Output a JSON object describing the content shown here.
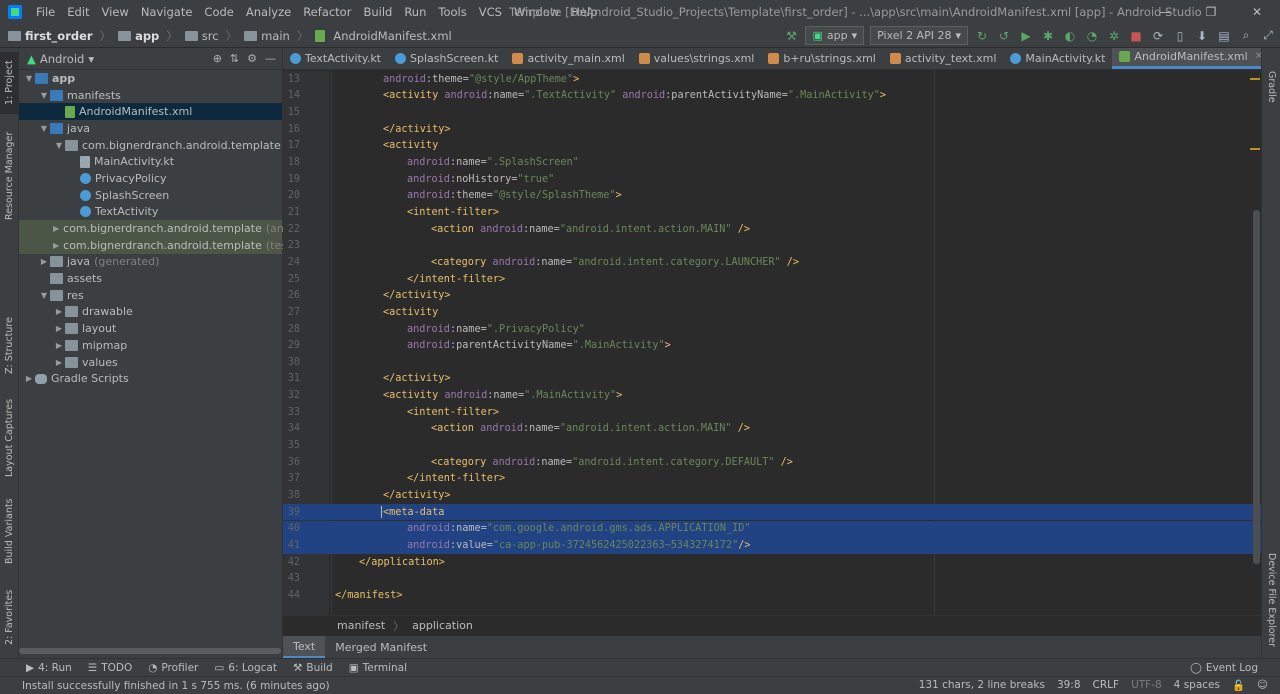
{
  "window": {
    "menu": [
      "File",
      "Edit",
      "View",
      "Navigate",
      "Code",
      "Analyze",
      "Refactor",
      "Build",
      "Run",
      "Tools",
      "VCS",
      "Window",
      "Help"
    ],
    "title": "Template [D:\\Android_Studio_Projects\\Template\\first_order] - ...\\app\\src\\main\\AndroidManifest.xml [app] - Android Studio",
    "controls": {
      "minimize": "—",
      "restore": "❐",
      "close": "✕"
    }
  },
  "breadcrumb": {
    "items": [
      "first_order",
      "app",
      "src",
      "main",
      "AndroidManifest.xml"
    ]
  },
  "run_toolbar": {
    "config": "app",
    "device": "Pixel 2 API 28"
  },
  "left_tool_windows": [
    "1: Project",
    "Resource Manager",
    "Z: Structure",
    "Layout Captures",
    "Build Variants",
    "2: Favorites"
  ],
  "right_tool_windows": [
    "Gradle",
    "Device File Explorer"
  ],
  "project_panel": {
    "view": "Android",
    "tree": [
      {
        "label": "app",
        "depth": 0,
        "expanded": true,
        "icon": "folder-blue",
        "bold": true
      },
      {
        "label": "manifests",
        "depth": 1,
        "expanded": true,
        "icon": "folder-blue"
      },
      {
        "label": "AndroidManifest.xml",
        "depth": 2,
        "icon": "manifest",
        "selected": true
      },
      {
        "label": "java",
        "depth": 1,
        "expanded": true,
        "icon": "folder-blue"
      },
      {
        "label": "com.bignerdranch.android.template",
        "depth": 2,
        "expanded": true,
        "icon": "package"
      },
      {
        "label": "MainActivity.kt",
        "depth": 3,
        "icon": "kt-file"
      },
      {
        "label": "PrivacyPolicy",
        "depth": 3,
        "icon": "kt-class"
      },
      {
        "label": "SplashScreen",
        "depth": 3,
        "icon": "kt-class"
      },
      {
        "label": "TextActivity",
        "depth": 3,
        "icon": "kt-class"
      },
      {
        "label": "com.bignerdranch.android.template",
        "suffix": "(androidT",
        "depth": 2,
        "collapsed": true,
        "icon": "package",
        "green": true
      },
      {
        "label": "com.bignerdranch.android.template",
        "suffix": "(test)",
        "depth": 2,
        "collapsed": true,
        "icon": "package",
        "green": true
      },
      {
        "label": "java",
        "suffix": "(generated)",
        "depth": 1,
        "collapsed": true,
        "icon": "folder"
      },
      {
        "label": "assets",
        "depth": 1,
        "icon": "folder"
      },
      {
        "label": "res",
        "depth": 1,
        "expanded": true,
        "icon": "folder"
      },
      {
        "label": "drawable",
        "depth": 2,
        "collapsed": true,
        "icon": "folder"
      },
      {
        "label": "layout",
        "depth": 2,
        "collapsed": true,
        "icon": "folder"
      },
      {
        "label": "mipmap",
        "depth": 2,
        "collapsed": true,
        "icon": "folder"
      },
      {
        "label": "values",
        "depth": 2,
        "collapsed": true,
        "icon": "folder"
      },
      {
        "label": "Gradle Scripts",
        "depth": 0,
        "collapsed": true,
        "icon": "gradle"
      }
    ]
  },
  "editor_tabs": [
    {
      "label": "TextActivity.kt",
      "icon": "kt"
    },
    {
      "label": "SplashScreen.kt",
      "icon": "kt"
    },
    {
      "label": "activity_main.xml",
      "icon": "xml"
    },
    {
      "label": "values\\strings.xml",
      "icon": "xml"
    },
    {
      "label": "b+ru\\strings.xml",
      "icon": "xml"
    },
    {
      "label": "activity_text.xml",
      "icon": "xml"
    },
    {
      "label": "MainActivity.kt",
      "icon": "kt"
    },
    {
      "label": "AndroidManifest.xml",
      "icon": "manifest",
      "active": true
    }
  ],
  "code_lines": [
    {
      "n": 13,
      "indent": 2,
      "parts": [
        [
          "ns",
          "android"
        ],
        [
          "at",
          ":theme="
        ],
        [
          "vl",
          "\"@style/AppTheme\""
        ],
        [
          "tg",
          ">"
        ]
      ]
    },
    {
      "n": 14,
      "indent": 2,
      "parts": [
        [
          "tg",
          "<activity "
        ],
        [
          "ns",
          "android"
        ],
        [
          "at",
          ":name="
        ],
        [
          "vl",
          "\".TextActivity\" "
        ],
        [
          "ns",
          "android"
        ],
        [
          "at",
          ":parentActivityName="
        ],
        [
          "vl",
          "\".MainActivity\""
        ],
        [
          "tg",
          ">"
        ]
      ]
    },
    {
      "n": 15,
      "indent": 0,
      "parts": []
    },
    {
      "n": 16,
      "indent": 2,
      "parts": [
        [
          "tg",
          "</activity>"
        ]
      ]
    },
    {
      "n": 17,
      "indent": 2,
      "parts": [
        [
          "tg",
          "<activity"
        ]
      ]
    },
    {
      "n": 18,
      "indent": 3,
      "parts": [
        [
          "ns",
          "android"
        ],
        [
          "at",
          ":name="
        ],
        [
          "vl",
          "\".SplashScreen\""
        ]
      ]
    },
    {
      "n": 19,
      "indent": 3,
      "parts": [
        [
          "ns",
          "android"
        ],
        [
          "at",
          ":noHistory="
        ],
        [
          "vl",
          "\"true\""
        ]
      ]
    },
    {
      "n": 20,
      "indent": 3,
      "parts": [
        [
          "ns",
          "android"
        ],
        [
          "at",
          ":theme="
        ],
        [
          "vl",
          "\"@style/SplashTheme\""
        ],
        [
          "tg",
          ">"
        ]
      ]
    },
    {
      "n": 21,
      "indent": 3,
      "parts": [
        [
          "tg",
          "<intent-filter>"
        ]
      ]
    },
    {
      "n": 22,
      "indent": 4,
      "parts": [
        [
          "tg",
          "<action "
        ],
        [
          "ns",
          "android"
        ],
        [
          "at",
          ":name="
        ],
        [
          "vl",
          "\"android.intent.action.MAIN\" "
        ],
        [
          "tg",
          "/>"
        ]
      ]
    },
    {
      "n": 23,
      "indent": 0,
      "parts": []
    },
    {
      "n": 24,
      "indent": 4,
      "parts": [
        [
          "tg",
          "<category "
        ],
        [
          "ns",
          "android"
        ],
        [
          "at",
          ":name="
        ],
        [
          "vl",
          "\"android.intent.category.LAUNCHER\" "
        ],
        [
          "tg",
          "/>"
        ]
      ]
    },
    {
      "n": 25,
      "indent": 3,
      "parts": [
        [
          "tg",
          "</intent-filter>"
        ]
      ]
    },
    {
      "n": 26,
      "indent": 2,
      "parts": [
        [
          "tg",
          "</activity>"
        ]
      ]
    },
    {
      "n": 27,
      "indent": 2,
      "parts": [
        [
          "tg",
          "<activity"
        ]
      ]
    },
    {
      "n": 28,
      "indent": 3,
      "parts": [
        [
          "ns",
          "android"
        ],
        [
          "at",
          ":name="
        ],
        [
          "vl",
          "\".PrivacyPolicy\""
        ]
      ]
    },
    {
      "n": 29,
      "indent": 3,
      "parts": [
        [
          "ns",
          "android"
        ],
        [
          "at",
          ":parentActivityName="
        ],
        [
          "vl",
          "\".MainActivity\""
        ],
        [
          "tg",
          ">"
        ]
      ]
    },
    {
      "n": 30,
      "indent": 0,
      "parts": []
    },
    {
      "n": 31,
      "indent": 2,
      "parts": [
        [
          "tg",
          "</activity>"
        ]
      ]
    },
    {
      "n": 32,
      "indent": 2,
      "parts": [
        [
          "tg",
          "<activity "
        ],
        [
          "ns",
          "android"
        ],
        [
          "at",
          ":name="
        ],
        [
          "vl",
          "\".MainActivity\""
        ],
        [
          "tg",
          ">"
        ]
      ]
    },
    {
      "n": 33,
      "indent": 3,
      "parts": [
        [
          "tg",
          "<intent-filter>"
        ]
      ]
    },
    {
      "n": 34,
      "indent": 4,
      "parts": [
        [
          "tg",
          "<action "
        ],
        [
          "ns",
          "android"
        ],
        [
          "at",
          ":name="
        ],
        [
          "vl",
          "\"android.intent.action.MAIN\" "
        ],
        [
          "tg",
          "/>"
        ]
      ]
    },
    {
      "n": 35,
      "indent": 0,
      "parts": []
    },
    {
      "n": 36,
      "indent": 4,
      "parts": [
        [
          "tg",
          "<category "
        ],
        [
          "ns",
          "android"
        ],
        [
          "at",
          ":name="
        ],
        [
          "vl",
          "\"android.intent.category.DEFAULT\" "
        ],
        [
          "tg",
          "/>"
        ]
      ]
    },
    {
      "n": 37,
      "indent": 3,
      "parts": [
        [
          "tg",
          "</intent-filter>"
        ]
      ]
    },
    {
      "n": 38,
      "indent": 2,
      "parts": [
        [
          "tg",
          "</activity>"
        ]
      ]
    },
    {
      "n": 39,
      "indent": 2,
      "hl": true,
      "parts": [
        [
          "tg",
          "<meta-data"
        ]
      ]
    },
    {
      "n": 40,
      "indent": 3,
      "hl": true,
      "parts": [
        [
          "ns",
          "android"
        ],
        [
          "at",
          ":name="
        ],
        [
          "vl",
          "\"com.google.android.gms.ads.APPLICATION_ID\""
        ]
      ]
    },
    {
      "n": 41,
      "indent": 3,
      "hl": true,
      "parts": [
        [
          "ns",
          "android"
        ],
        [
          "at",
          ":value="
        ],
        [
          "vl",
          "\"ca-app-pub-3724562425022363~5343274172\""
        ],
        [
          "tg",
          "/>"
        ]
      ]
    },
    {
      "n": 42,
      "indent": 1,
      "parts": [
        [
          "tg",
          "</application>"
        ]
      ]
    },
    {
      "n": 43,
      "indent": 0,
      "parts": []
    },
    {
      "n": 44,
      "indent": 0,
      "parts": [
        [
          "tg",
          "</manifest>"
        ]
      ]
    }
  ],
  "editor_breadcrumb": [
    "manifest",
    "application"
  ],
  "bottom_editor_tabs": [
    {
      "label": "Text",
      "active": true
    },
    {
      "label": "Merged Manifest"
    }
  ],
  "tool_windows_bar": {
    "items": [
      "4: Run",
      "TODO",
      "Profiler",
      "6: Logcat",
      "Build",
      "Terminal"
    ],
    "event_log": "Event Log"
  },
  "status": {
    "message": "Install successfully finished in 1 s 755 ms. (6 minutes ago)",
    "chars": "131 chars, 2 line breaks",
    "position": "39:8",
    "line_sep": "CRLF",
    "encoding": "UTF-8",
    "indent": "4 spaces"
  }
}
